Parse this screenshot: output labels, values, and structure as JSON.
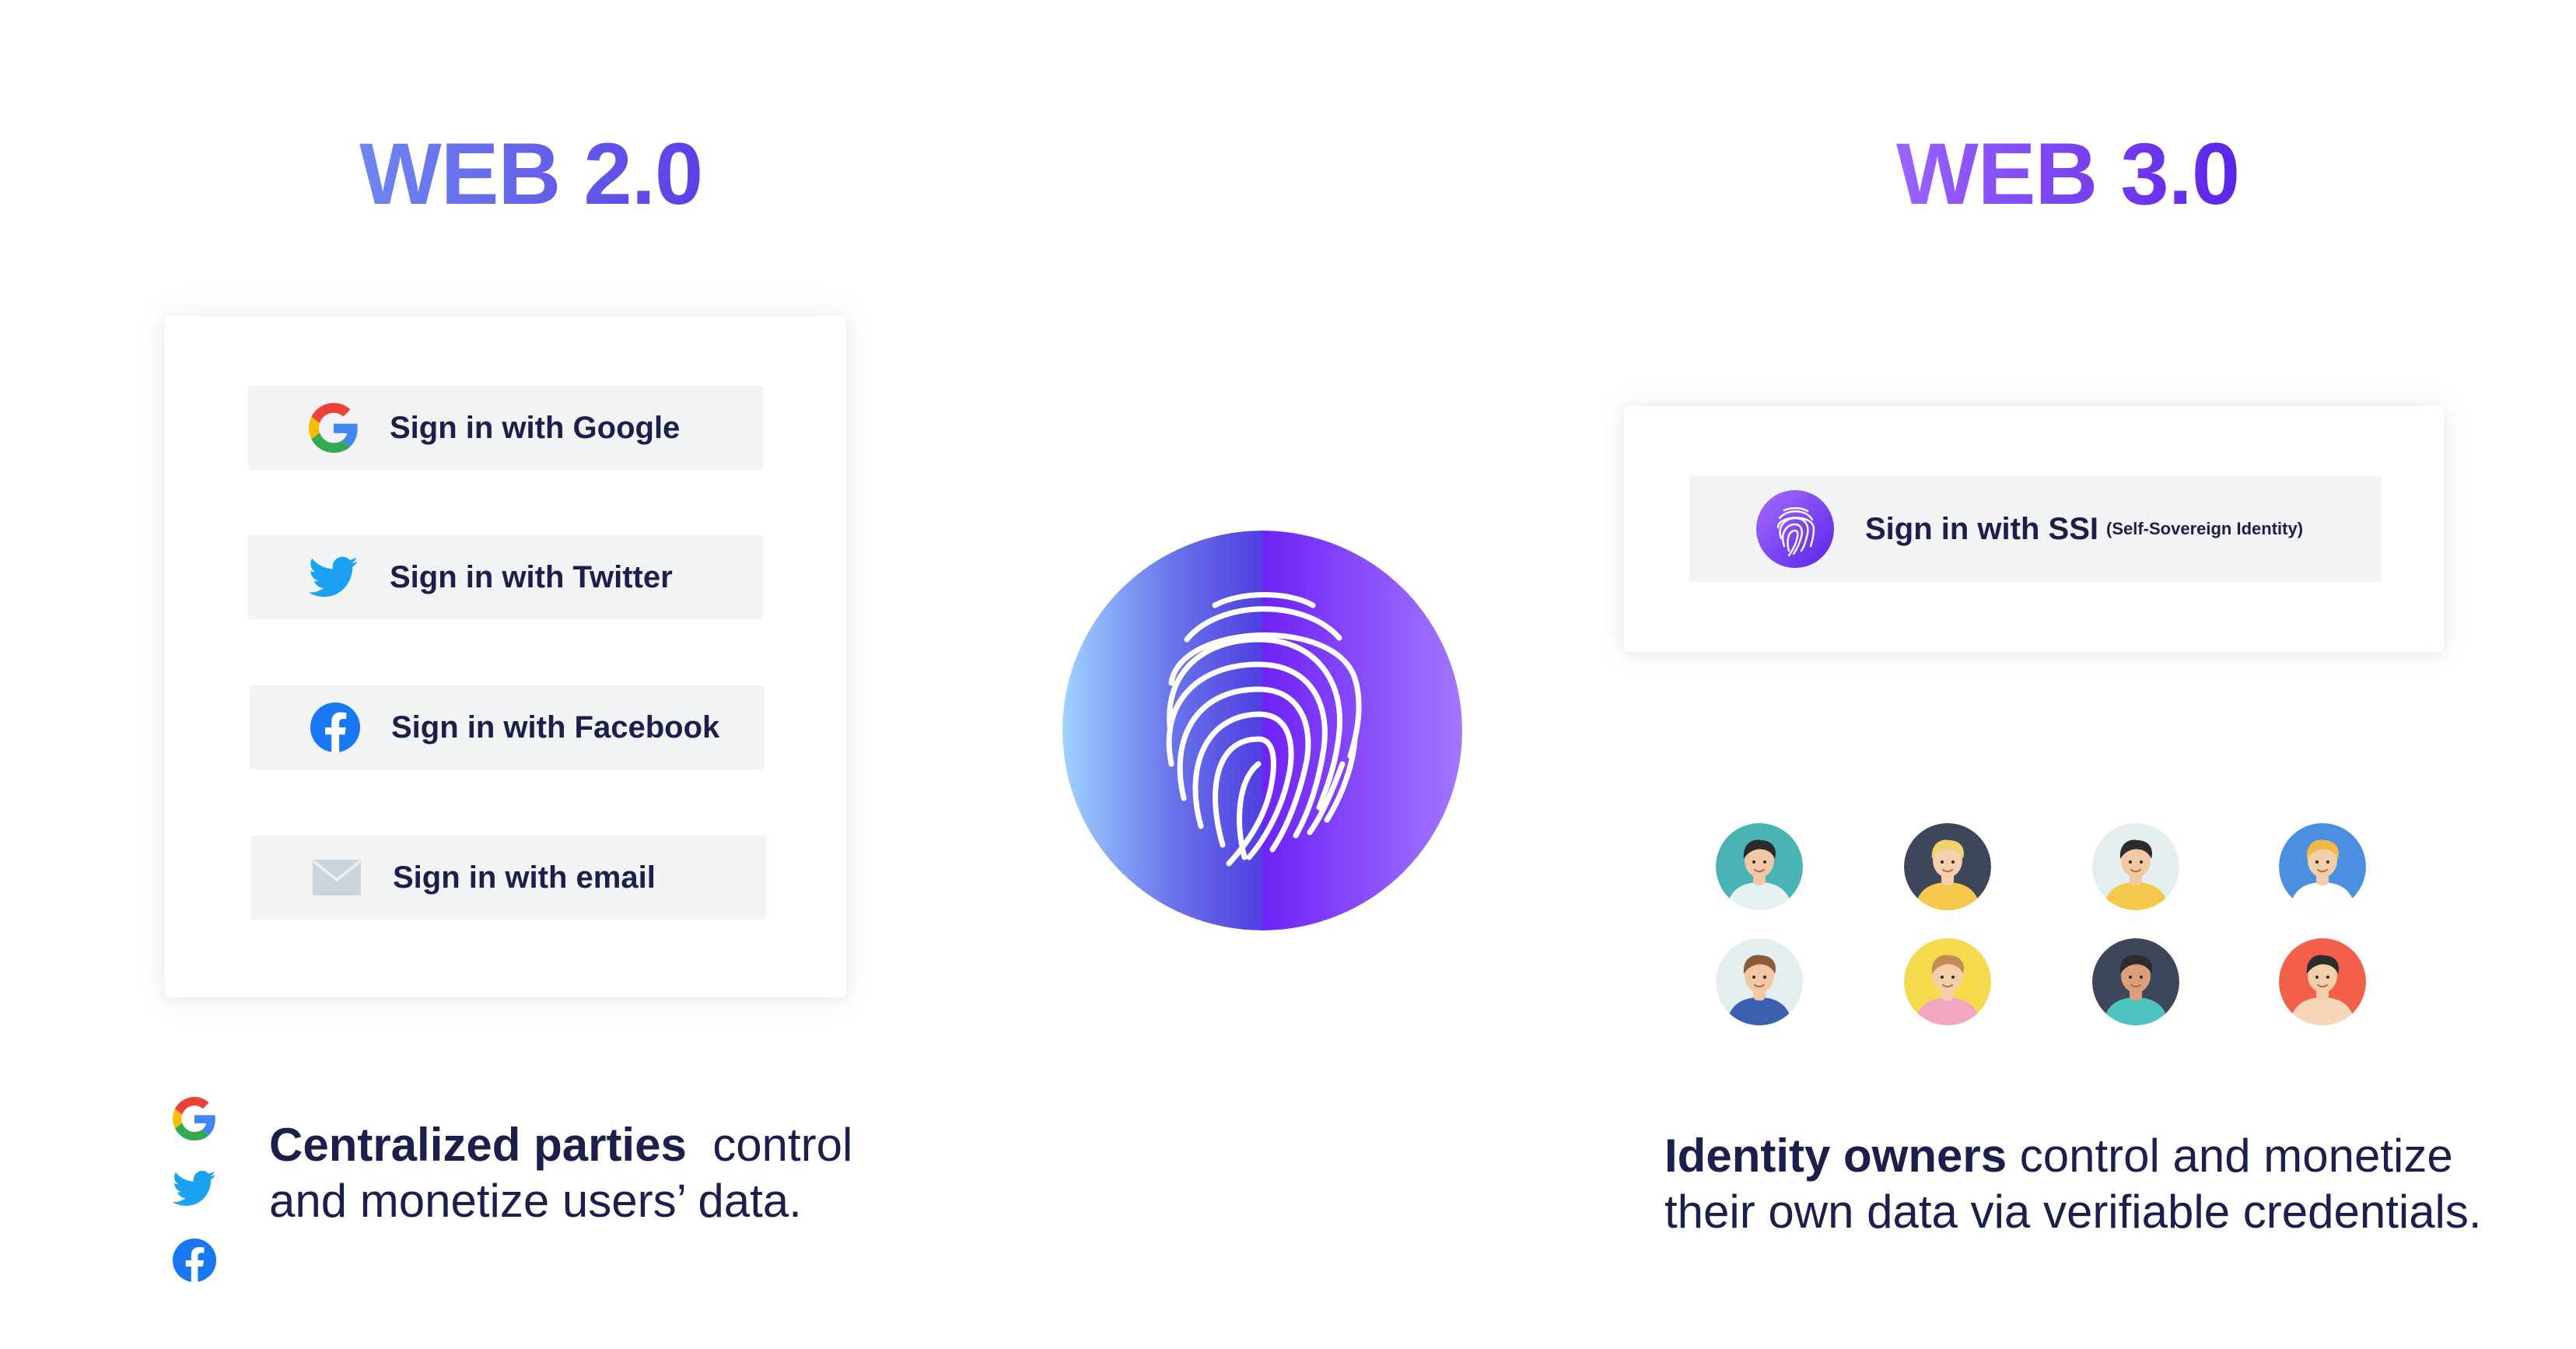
{
  "web2": {
    "title": "WEB 2.0",
    "buttons": [
      {
        "label": "Sign in with Google",
        "icon": "google-icon"
      },
      {
        "label": "Sign in with Twitter",
        "icon": "twitter-icon"
      },
      {
        "label": "Sign in with Facebook",
        "icon": "facebook-icon"
      },
      {
        "label": "Sign in with email",
        "icon": "email-icon"
      }
    ],
    "caption_bold": "Centralized parties",
    "caption_line1_rest": "control",
    "caption_line2": "and monetize users’ data."
  },
  "web3": {
    "title": "WEB 3.0",
    "button": {
      "label": "Sign in with SSI",
      "sub": "(Self-Sovereign Identity)",
      "icon": "fingerprint-icon"
    },
    "caption_bold": "Identity owners",
    "caption_line1_rest": "control and monetize",
    "caption_line2": "their own data via verifiable credentials."
  },
  "center": {
    "icon": "fingerprint-icon"
  },
  "colors": {
    "navy": "#1a1f4b",
    "web2_gradient_start": "#6f86f0",
    "web2_gradient_end": "#5b40e6",
    "web3_gradient_start": "#9b63ff",
    "web3_gradient_end": "#5a25e8",
    "button_bg": "#f2f3f5"
  },
  "avatars": [
    {
      "bg": "#4ab3b3",
      "skin": "#f1c7a5",
      "hair": "#2b2b2b",
      "shirt": "#e6f2f2"
    },
    {
      "bg": "#3e4659",
      "skin": "#f3d0b0",
      "hair": "#f0d36a",
      "shirt": "#f4c84a"
    },
    {
      "bg": "#e4eeee",
      "skin": "#f2c8a4",
      "hair": "#2c2c2c",
      "shirt": "#f4c84a"
    },
    {
      "bg": "#4a8fe0",
      "skin": "#f3cfa9",
      "hair": "#f2b845",
      "shirt": "#ffffff"
    },
    {
      "bg": "#e4eeee",
      "skin": "#f2c8a4",
      "hair": "#8b5a3c",
      "shirt": "#3c5fb0"
    },
    {
      "bg": "#f5da4e",
      "skin": "#f3cfa9",
      "hair": "#c68b54",
      "shirt": "#f3a7c0"
    },
    {
      "bg": "#3e4659",
      "skin": "#d9a07a",
      "hair": "#2c2c2c",
      "shirt": "#4ec3c0"
    },
    {
      "bg": "#f2604a",
      "skin": "#f3cfa9",
      "hair": "#2c2c2c",
      "shirt": "#f6d8b8"
    }
  ]
}
